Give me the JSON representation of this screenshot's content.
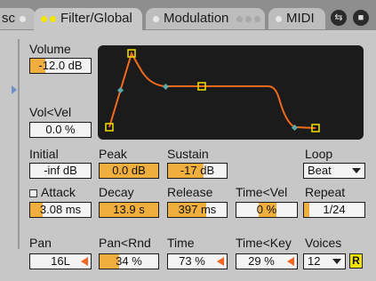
{
  "tabs": [
    {
      "label": "sc",
      "active": false
    },
    {
      "label": "Filter/Global",
      "active": true
    },
    {
      "label": "Modulation",
      "active": false
    },
    {
      "label": "MIDI",
      "active": false
    }
  ],
  "icons": {
    "hotswap": "hotswap-icon",
    "save": "save-icon",
    "expand": "expand-arrow-icon"
  },
  "volume": {
    "label": "Volume",
    "value": "-12.0 dB",
    "fill": 0.25
  },
  "vol_vel": {
    "label": "Vol<Vel",
    "value": "0.0 %"
  },
  "envelope": {
    "line_color": "#f26a1b",
    "points": [
      {
        "name": "initial",
        "shape": "square"
      },
      {
        "name": "peak",
        "shape": "square"
      },
      {
        "name": "decay",
        "shape": "diamond"
      },
      {
        "name": "sustain",
        "shape": "square"
      },
      {
        "name": "release",
        "shape": "diamond"
      },
      {
        "name": "end",
        "shape": "square"
      }
    ]
  },
  "params": {
    "initial": {
      "label": "Initial",
      "value": "-inf dB"
    },
    "peak": {
      "label": "Peak",
      "value": "0.0 dB",
      "fill": 1.0
    },
    "sustain": {
      "label": "Sustain",
      "value": "-17 dB",
      "fill": 0.6
    },
    "loop": {
      "label": "Loop",
      "value": "Beat"
    },
    "attack": {
      "label": "Attack",
      "value": "3.08 ms",
      "fill": 0.2
    },
    "decay": {
      "label": "Decay",
      "value": "13.9 s",
      "fill": 1.0
    },
    "release": {
      "label": "Release",
      "value": "397 ms",
      "fill": 0.65
    },
    "time_vel": {
      "label": "Time<Vel",
      "value": "0 %",
      "fill": 0.5
    },
    "repeat": {
      "label": "Repeat",
      "value": "1/24",
      "fill": 0.1
    },
    "pan": {
      "label": "Pan",
      "value": "16L"
    },
    "pan_rnd": {
      "label": "Pan<Rnd",
      "value": "34 %",
      "fill": 0.34
    },
    "time": {
      "label": "Time",
      "value": "73 %"
    },
    "time_key": {
      "label": "Time<Key",
      "value": "29 %"
    },
    "voices": {
      "label": "Voices",
      "value": "12"
    },
    "retrigger": {
      "label": "R"
    }
  }
}
